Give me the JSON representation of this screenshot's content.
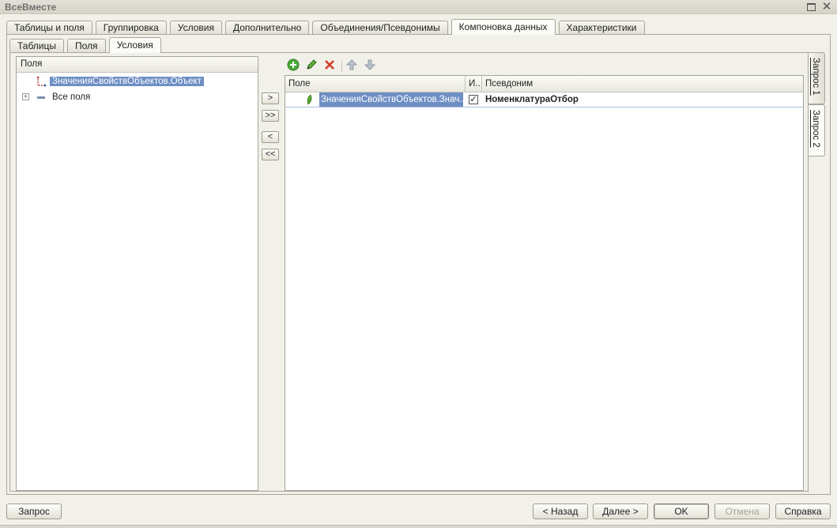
{
  "window": {
    "title": "ВсеВместе"
  },
  "main_tabs": [
    {
      "label": "Таблицы и поля"
    },
    {
      "label": "Группировка"
    },
    {
      "label": "Условия"
    },
    {
      "label": "Дополнительно"
    },
    {
      "label": "Объединения/Псевдонимы"
    },
    {
      "label": "Компоновка данных",
      "active": true
    },
    {
      "label": "Характеристики"
    }
  ],
  "sub_tabs": [
    {
      "label": "Таблицы"
    },
    {
      "label": "Поля"
    },
    {
      "label": "Условия",
      "active": true
    }
  ],
  "fields_panel": {
    "header": "Поля",
    "items": [
      {
        "label": "ЗначенияСвойствОбъектов.Объект",
        "selected": true,
        "icon": "field-link-icon"
      },
      {
        "label": "Все поля",
        "icon": "field-group-icon",
        "expandable": true
      }
    ]
  },
  "move_buttons": {
    "add": ">",
    "add_all": ">>",
    "remove": "<",
    "remove_all": "<<"
  },
  "toolbar": {
    "icons": [
      "add-icon",
      "edit-icon",
      "delete-icon",
      "move-up-icon",
      "move-down-icon"
    ]
  },
  "conditions_grid": {
    "columns": [
      "Поле",
      "И..",
      "Псевдоним"
    ],
    "rows": [
      {
        "field": "ЗначенияСвойствОбъектов.Знач...",
        "checked": true,
        "alias": "НоменклатураОтбор"
      }
    ]
  },
  "query_tabs": [
    {
      "label": "Запрос 1"
    },
    {
      "label": "Запрос 2",
      "active": true
    }
  ],
  "footer": {
    "query": "Запрос",
    "back": "< Назад",
    "next": "Далее >",
    "ok": "OK",
    "cancel": "Отмена",
    "help": "Справка"
  },
  "colors": {
    "background": "#f2f1e9",
    "selection": "#6e8fc4",
    "border": "#a8a69a"
  }
}
